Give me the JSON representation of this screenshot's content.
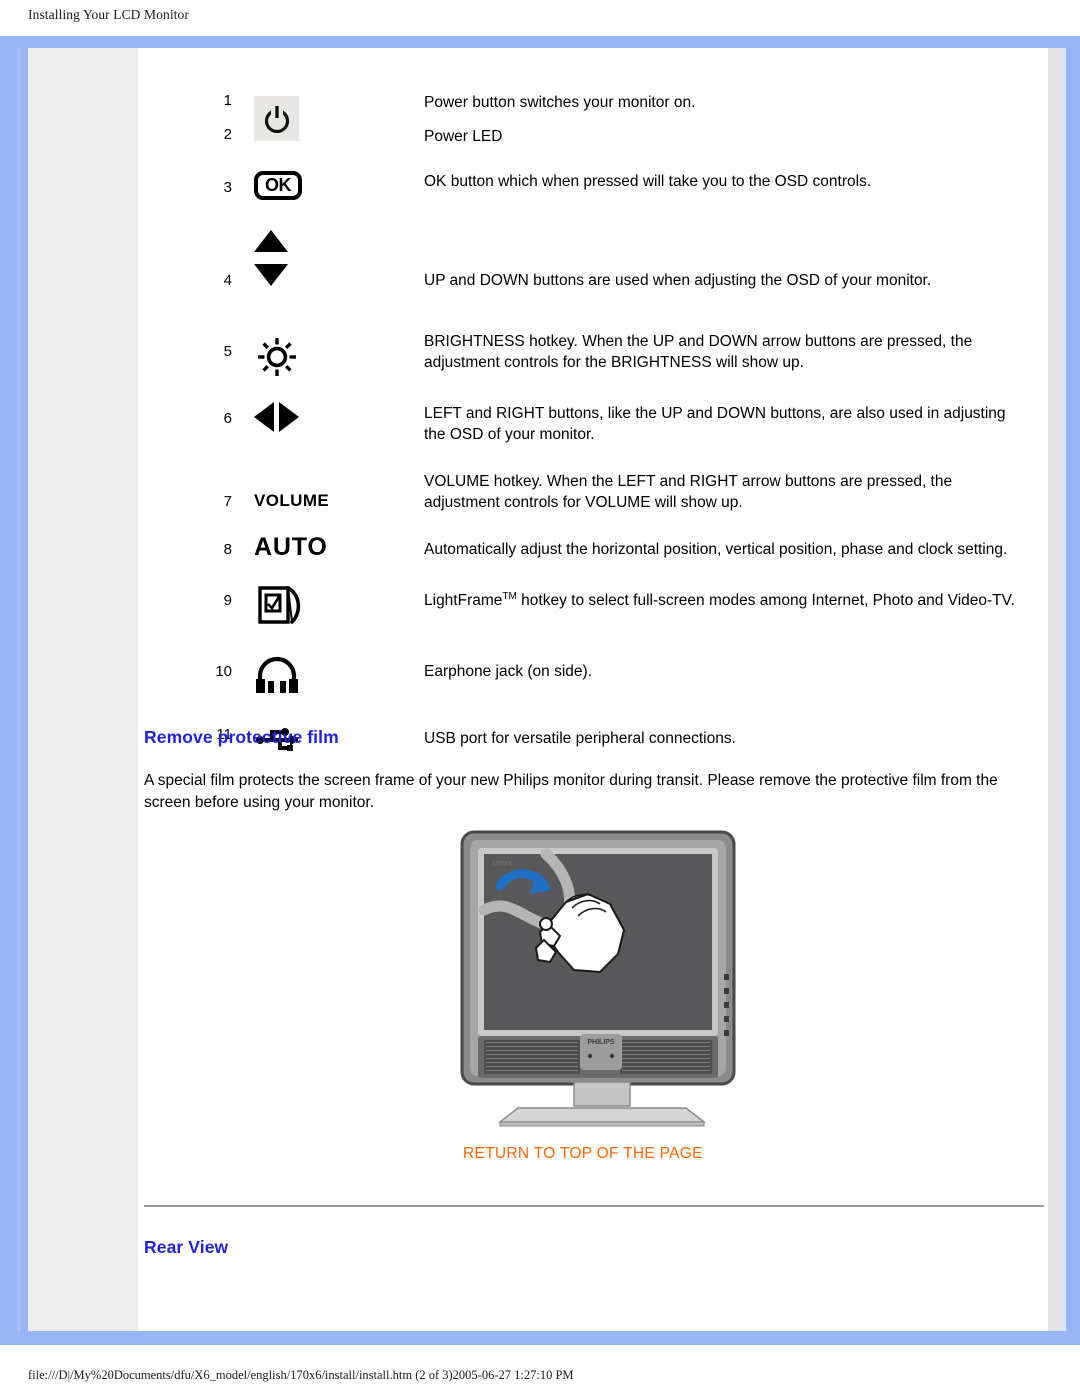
{
  "header": {
    "title": "Installing Your LCD Monitor"
  },
  "controls": {
    "items": [
      {
        "num": "1",
        "icon": "power-button-icon",
        "desc": "Power button switches your monitor on."
      },
      {
        "num": "2",
        "icon": "power-led-icon",
        "desc": "Power LED"
      },
      {
        "num": "3",
        "icon": "ok-button-icon",
        "icon_label": "OK",
        "desc": "OK button which when pressed will take you to the OSD controls."
      },
      {
        "num": "4",
        "icon": "up-down-arrows-icon",
        "desc": "UP and DOWN buttons are used when adjusting the OSD of your monitor."
      },
      {
        "num": "5",
        "icon": "brightness-icon",
        "desc": "BRIGHTNESS hotkey. When the UP and DOWN arrow buttons are pressed, the adjustment controls for the BRIGHTNESS will show up."
      },
      {
        "num": "6",
        "icon": "left-right-arrows-icon",
        "desc": "LEFT and RIGHT buttons, like the UP and DOWN buttons, are also used in adjusting the OSD of your monitor."
      },
      {
        "num": "7",
        "icon": "volume-label-icon",
        "icon_label": "VOLUME",
        "desc": "VOLUME hotkey. When the LEFT and RIGHT arrow buttons are pressed, the adjustment controls for VOLUME will show up."
      },
      {
        "num": "8",
        "icon": "auto-label-icon",
        "icon_label": "AUTO",
        "desc": "Automatically adjust the horizontal position, vertical position, phase and clock setting."
      },
      {
        "num": "9",
        "icon": "lightframe-icon",
        "desc_prefix": "LightFrame",
        "desc_sup": "TM",
        "desc_rest": " hotkey to select full-screen modes among Internet, Photo and Video-TV."
      },
      {
        "num": "10",
        "icon": "headphone-icon",
        "desc": "Earphone jack (on side)."
      },
      {
        "num": "11",
        "icon": "usb-icon",
        "desc": "USB port for versatile peripheral connections."
      }
    ]
  },
  "sections": {
    "remove_film": {
      "heading": "Remove protective film",
      "paragraph": "A special film protects the screen frame of your new Philips monitor during transit. Please remove the protective film from the screen before using your monitor."
    },
    "rear_view": {
      "heading": "Rear View"
    }
  },
  "illustration": {
    "name": "philips-monitor-remove-film",
    "brand_logo": "PHILIPS",
    "screen_badge": "170X6",
    "arrow_color": "#1f6fc4"
  },
  "links": {
    "return_to_top": "RETURN TO TOP OF THE PAGE"
  },
  "footer": {
    "path": "file:///D|/My%20Documents/dfu/X6_model/english/170x6/install/install.htm (2 of 3)2005-06-27 1:27:10 PM"
  },
  "colors": {
    "frame_blue": "#9ab5f7",
    "heading_blue": "#2222dd",
    "link_orange": "#ff6600",
    "sidebar_gray": "#eeeeee"
  }
}
